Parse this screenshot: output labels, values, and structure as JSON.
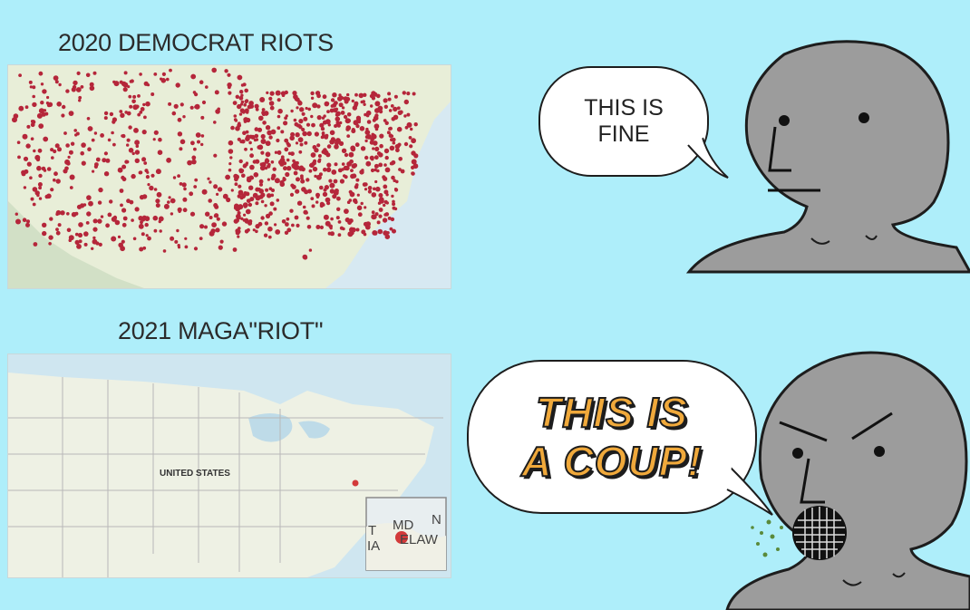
{
  "panel_top": {
    "title": "2020 DEMOCRAT RIOTS",
    "speech": [
      "THIS IS",
      "FINE"
    ]
  },
  "panel_bottom": {
    "title": "2021 MAGA\"RIOT\"",
    "map_label": "UNITED STATES",
    "inset_labels": [
      "MD",
      "ELAW",
      "T",
      "IA",
      "N"
    ],
    "speech": [
      "THIS IS",
      "A COUP!"
    ]
  },
  "colors": {
    "background": "#aeeefa",
    "riot_dot": "#b5263a",
    "npc_skin": "#9c9c9c",
    "speech_accent": "#f0a93b"
  }
}
